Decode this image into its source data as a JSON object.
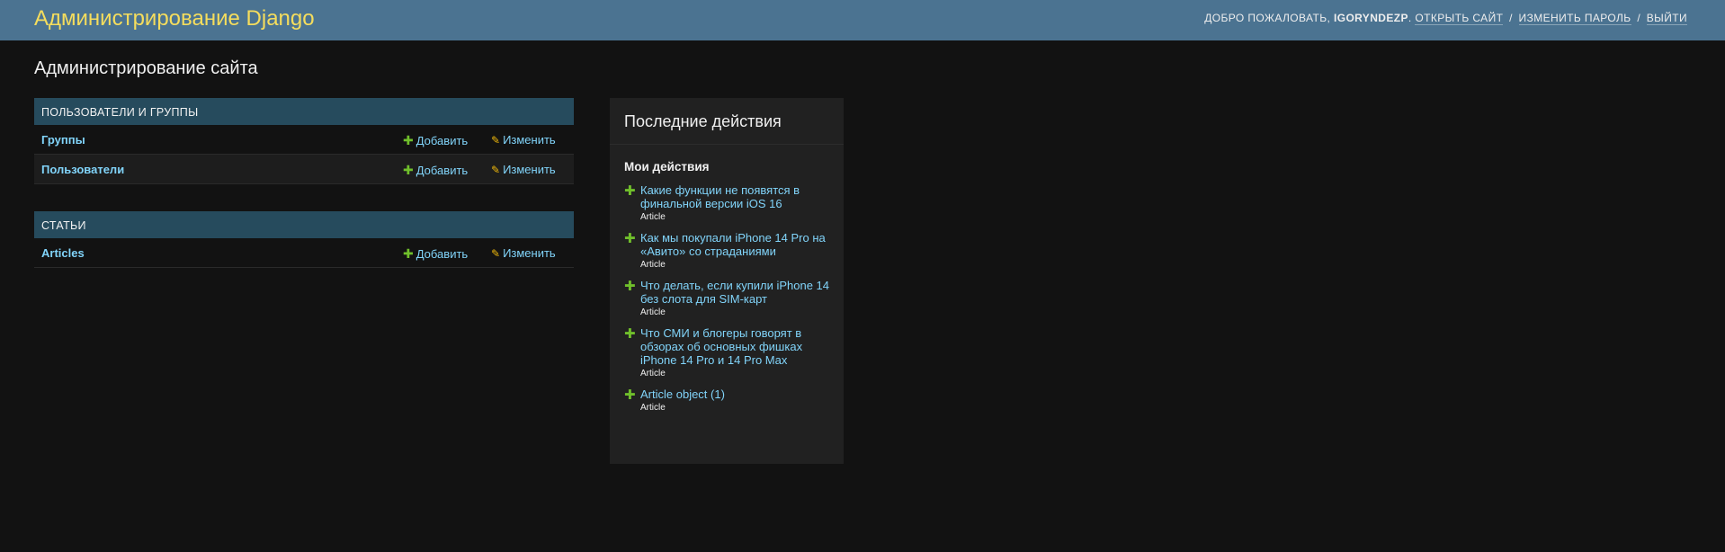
{
  "header": {
    "branding": "Администрирование Django",
    "welcome": "Добро пожаловать,",
    "username": "IGORYNDEZP",
    "view_site": "Открыть сайт",
    "change_password": "Изменить пароль",
    "logout": "Выйти"
  },
  "page_title": "Администрирование сайта",
  "modules": [
    {
      "caption": "Пользователи и группы",
      "models": [
        {
          "name": "Группы",
          "add": "Добавить",
          "change": "Изменить"
        },
        {
          "name": "Пользователи",
          "add": "Добавить",
          "change": "Изменить"
        }
      ]
    },
    {
      "caption": "Статьи",
      "models": [
        {
          "name": "Articles",
          "add": "Добавить",
          "change": "Изменить"
        }
      ]
    }
  ],
  "recent": {
    "title": "Последние действия",
    "subtitle": "Мои действия",
    "items": [
      {
        "title": "Какие функции не появятся в финальной версии iOS 16",
        "type": "Article"
      },
      {
        "title": "Как мы покупали iPhone 14 Pro на «Авито» со страданиями",
        "type": "Article"
      },
      {
        "title": "Что делать, если купили iPhone 14 без слота для SIM-карт",
        "type": "Article"
      },
      {
        "title": "Что СМИ и блогеры говорят в обзорах об основных фишках iPhone 14 Pro и 14 Pro Max",
        "type": "Article"
      },
      {
        "title": "Article object (1)",
        "type": "Article"
      }
    ]
  },
  "colors": {
    "header_bg": "#4b7391",
    "branding": "#f5dd5d",
    "caption_bg": "#264b5d",
    "link": "#81d4fa",
    "add_icon": "#70bf2b",
    "change_icon": "#efb80b",
    "body_bg": "#121212"
  },
  "icons": {
    "add": "plus-icon",
    "change": "pencil-icon"
  }
}
